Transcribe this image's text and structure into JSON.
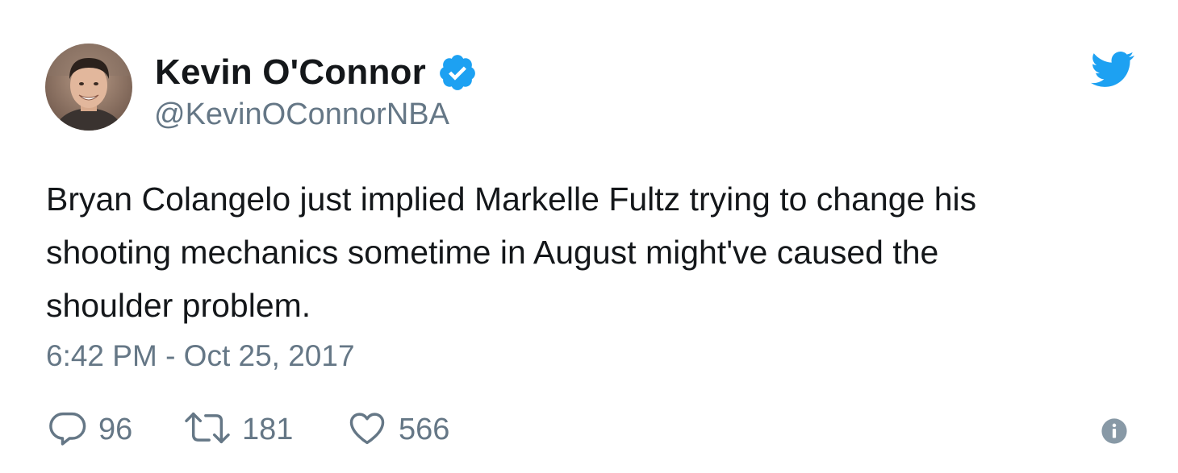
{
  "author": {
    "display_name": "Kevin O'Connor",
    "handle": "@KevinOConnorNBA",
    "verified": true,
    "verified_icon": "verified-badge-icon"
  },
  "brand": {
    "icon": "twitter-bird-icon",
    "accent_color": "#1da1f2"
  },
  "tweet": {
    "text": "Bryan Colangelo just implied Markelle Fultz trying to change his\nshooting mechanics sometime in August might've caused the\nshoulder problem.",
    "timestamp": "6:42 PM - Oct 25, 2017"
  },
  "actions": {
    "reply": {
      "icon": "reply-icon",
      "count": "96"
    },
    "retweet": {
      "icon": "retweet-icon",
      "count": "181"
    },
    "like": {
      "icon": "heart-icon",
      "count": "566"
    },
    "info": {
      "icon": "info-icon"
    }
  },
  "colors": {
    "text_primary": "#14171a",
    "text_secondary": "#657786",
    "icon_gray": "#8899a6"
  }
}
